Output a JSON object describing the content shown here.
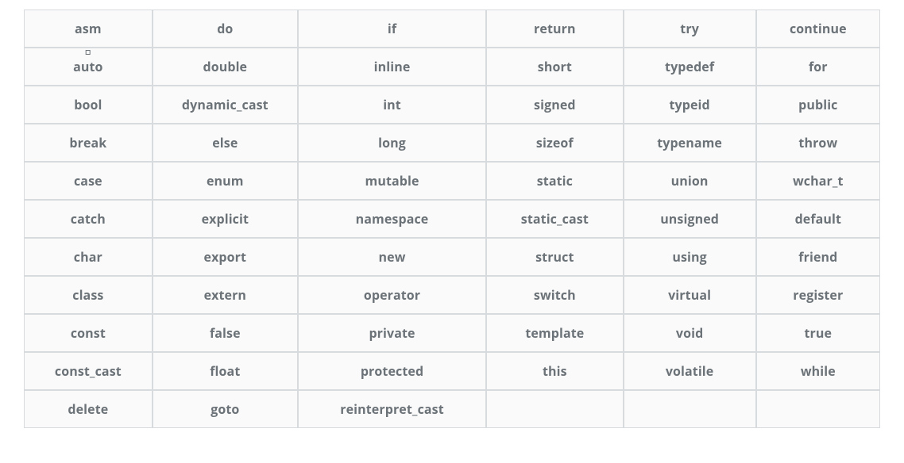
{
  "table": {
    "columns": 6,
    "rows": [
      [
        "asm",
        "do",
        "if",
        "return",
        "try",
        "continue"
      ],
      [
        "auto",
        "double",
        "inline",
        "short",
        "typedef",
        "for"
      ],
      [
        "bool",
        "dynamic_cast",
        "int",
        "signed",
        "typeid",
        "public"
      ],
      [
        "break",
        "else",
        "long",
        "sizeof",
        "typename",
        "throw"
      ],
      [
        "case",
        "enum",
        "mutable",
        "static",
        "union",
        "wchar_t"
      ],
      [
        "catch",
        "explicit",
        "namespace",
        "static_cast",
        "unsigned",
        "default"
      ],
      [
        "char",
        "export",
        "new",
        "struct",
        "using",
        "friend"
      ],
      [
        "class",
        "extern",
        "operator",
        "switch",
        "virtual",
        "register"
      ],
      [
        "const",
        "false",
        "private",
        "template",
        "void",
        "true"
      ],
      [
        "const_cast",
        "float",
        "protected",
        "this",
        "volatile",
        "while"
      ],
      [
        "delete",
        "goto",
        "reinterpret_cast",
        "",
        "",
        ""
      ]
    ],
    "markers": [
      {
        "row": 1,
        "col": 0,
        "type": "square"
      }
    ],
    "colors": {
      "text": "#6c7378",
      "border": "#d8dbde",
      "cell_bg": "#fafafa"
    }
  }
}
